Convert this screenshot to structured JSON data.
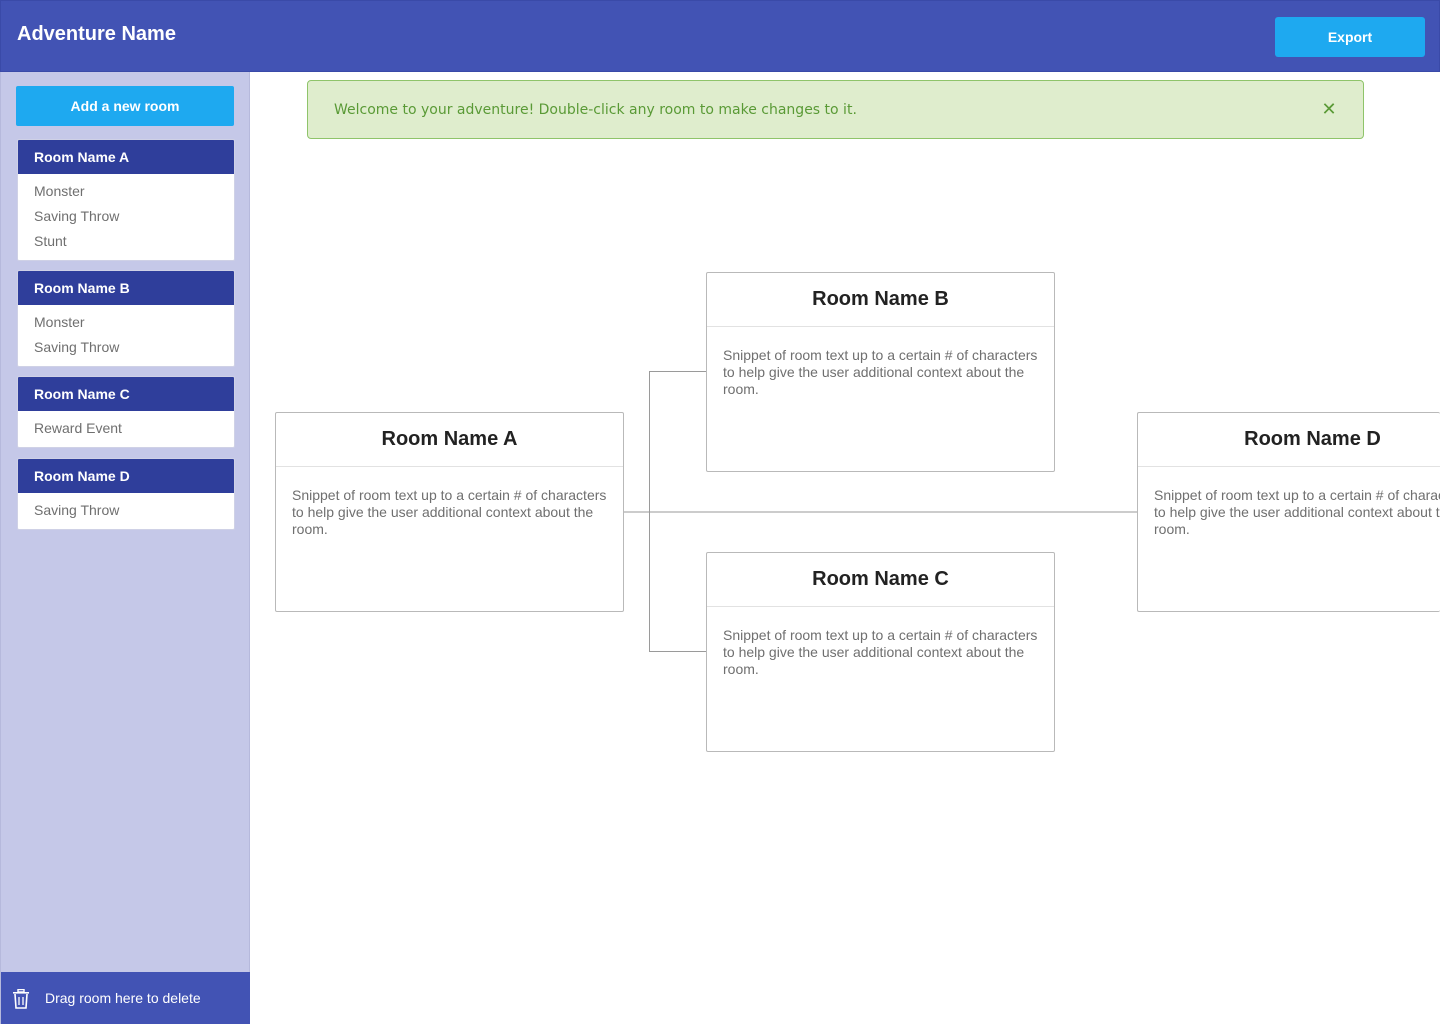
{
  "header": {
    "title": "Adventure Name",
    "export_label": "Export"
  },
  "sidebar": {
    "add_room_label": "Add a new room",
    "rooms": [
      {
        "name": "Room Name A",
        "items": [
          "Monster",
          "Saving Throw",
          "Stunt"
        ]
      },
      {
        "name": "Room Name B",
        "items": [
          "Monster",
          "Saving Throw"
        ]
      },
      {
        "name": "Room Name C",
        "items": [
          "Reward Event"
        ]
      },
      {
        "name": "Room Name D",
        "items": [
          "Saving Throw"
        ]
      }
    ],
    "delete_zone_label": "Drag room here to delete"
  },
  "alert": {
    "message": "Welcome to your adventure! Double-click any room to make changes to it.",
    "close_icon": "close-icon"
  },
  "map": {
    "rooms": [
      {
        "name": "Room Name A",
        "snippet": "Snippet of room text up to a certain # of characters to help give the user additional context about the room."
      },
      {
        "name": "Room Name B",
        "snippet": "Snippet of room text up to a certain # of characters to help give the user additional context about the room."
      },
      {
        "name": "Room Name C",
        "snippet": "Snippet of room text up to a certain # of characters to help give the user additional context about the room."
      },
      {
        "name": "Room Name D",
        "snippet": "Snippet of room text up to a certain # of characters to help give the user additional context about the room."
      }
    ]
  },
  "colors": {
    "header": "#4253b4",
    "accent_button": "#1ea9f0",
    "room_header": "#2f3e9b",
    "sidebar": "#c5c8e8",
    "alert_bg": "#dfedcd",
    "alert_text": "#5a9a36"
  },
  "icons": {
    "trash": "trash-icon"
  }
}
